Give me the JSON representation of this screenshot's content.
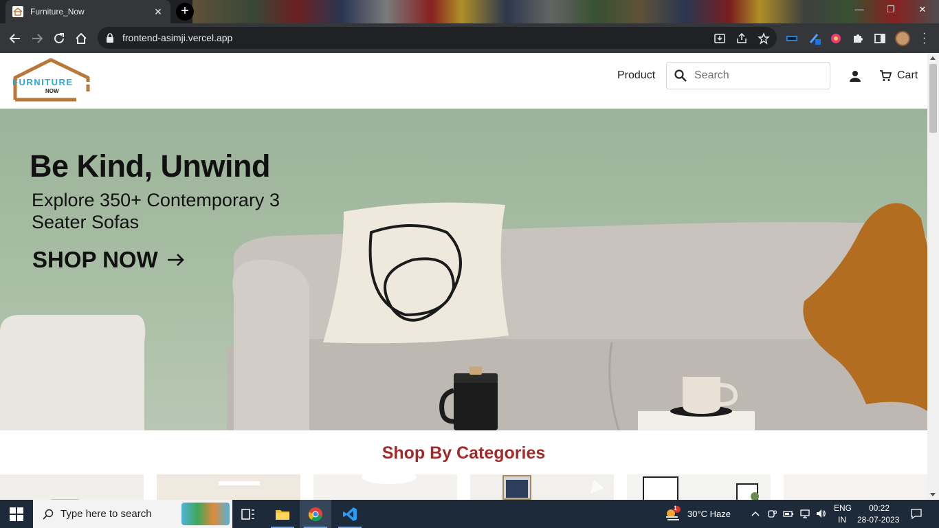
{
  "browser": {
    "tab_title": "Furniture_Now",
    "tab_close": "✕",
    "new_tab": "+",
    "url": "frontend-asimji.vercel.app",
    "window_controls": [
      "—",
      "❐",
      "✕"
    ]
  },
  "site": {
    "logo_text": "FURNITURE",
    "logo_subtext": "NOW",
    "nav": {
      "product": "Product",
      "search_placeholder": "Search",
      "cart": "Cart"
    },
    "hero": {
      "title": "Be Kind, Unwind",
      "subtitle": "Explore 350+ Contemporary 3 Seater Sofas",
      "cta": "SHOP NOW"
    },
    "section_title": "Shop By Categories",
    "categories_count_visible": 6
  },
  "taskbar": {
    "search_placeholder": "Type here to search",
    "weather": "30°C  Haze",
    "weather_badge": "1",
    "lang_top": "ENG",
    "lang_bottom": "IN",
    "time": "00:22",
    "date": "28-07-2023"
  },
  "colors": {
    "accent_title": "#a32a2a",
    "logo_brown": "#b8783a",
    "logo_blue": "#2aa9d8"
  }
}
